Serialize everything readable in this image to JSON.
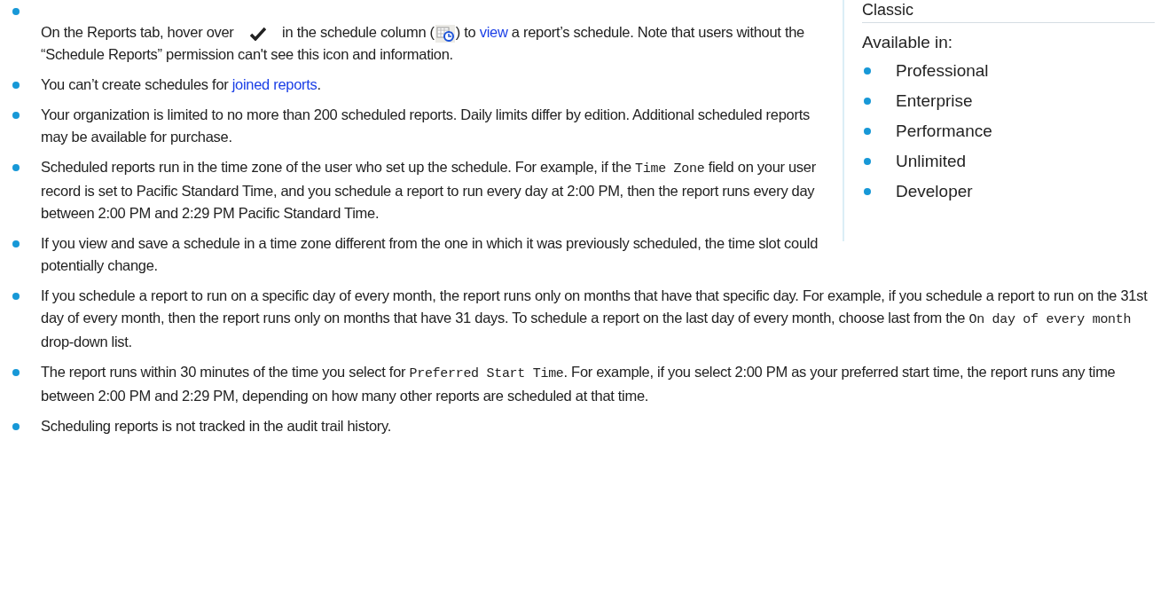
{
  "sidebar": {
    "heading": "Classic",
    "available_label": "Available in:",
    "editions": [
      {
        "name": "Professional"
      },
      {
        "name": "Enterprise"
      },
      {
        "name": "Performance"
      },
      {
        "name": "Unlimited"
      },
      {
        "name": "Developer"
      }
    ]
  },
  "notes": [
    {
      "parts": [
        {
          "kind": "text",
          "text": "On the Reports tab, hover over "
        },
        {
          "kind": "check_icon"
        },
        {
          "kind": "text",
          "text": " in the schedule column ("
        },
        {
          "kind": "schedule_icon"
        },
        {
          "kind": "text",
          "text": ") to "
        },
        {
          "kind": "link",
          "text": "view"
        },
        {
          "kind": "text",
          "text": " a report’s schedule. Note that users without the “Schedule Reports” permission can't see this icon and information."
        }
      ]
    },
    {
      "parts": [
        {
          "kind": "text",
          "text": "You can’t create schedules for "
        },
        {
          "kind": "link",
          "text": "joined reports"
        },
        {
          "kind": "text",
          "text": "."
        }
      ]
    },
    {
      "parts": [
        {
          "kind": "text",
          "text": "Your organization is limited to no more than 200 scheduled reports. Daily limits differ by edition. Additional scheduled reports may be available for purchase."
        }
      ]
    },
    {
      "parts": [
        {
          "kind": "text",
          "text": "Scheduled reports run in the time zone of the user who set up the schedule. For example, if the "
        },
        {
          "kind": "code",
          "text": "Time Zone"
        },
        {
          "kind": "text",
          "text": " field on your user record is set to Pacific Standard Time, and you schedule a report to run every day at 2:00 PM, then the report runs every day between 2:00 PM and 2:29 PM Pacific Standard Time."
        }
      ]
    },
    {
      "parts": [
        {
          "kind": "text",
          "text": "If you view and save a schedule in a time zone different from the one in which it was previously scheduled, the time slot could potentially change."
        }
      ]
    },
    {
      "parts": [
        {
          "kind": "text",
          "text": "If you schedule a report to run on a specific day of every month, the report runs only on months that have that specific day. For example, if you schedule a report to run on the 31st day of every month, then the report runs only on months that have 31 days. To schedule a report on the last day of every month, choose last from the "
        },
        {
          "kind": "code",
          "text": "On day of every month"
        },
        {
          "kind": "text",
          "text": " drop-down list."
        }
      ]
    },
    {
      "parts": [
        {
          "kind": "text",
          "text": "The report runs within 30 minutes of the time you select for "
        },
        {
          "kind": "code",
          "text": "Preferred Start Time"
        },
        {
          "kind": "text",
          "text": ". For example, if you select 2:00 PM as your preferred start time, the report runs any time between 2:00 PM and 2:29 PM, depending on how many other reports are scheduled at that time."
        }
      ]
    },
    {
      "parts": [
        {
          "kind": "text",
          "text": "Scheduling reports is not tracked in the audit trail history."
        }
      ]
    }
  ]
}
